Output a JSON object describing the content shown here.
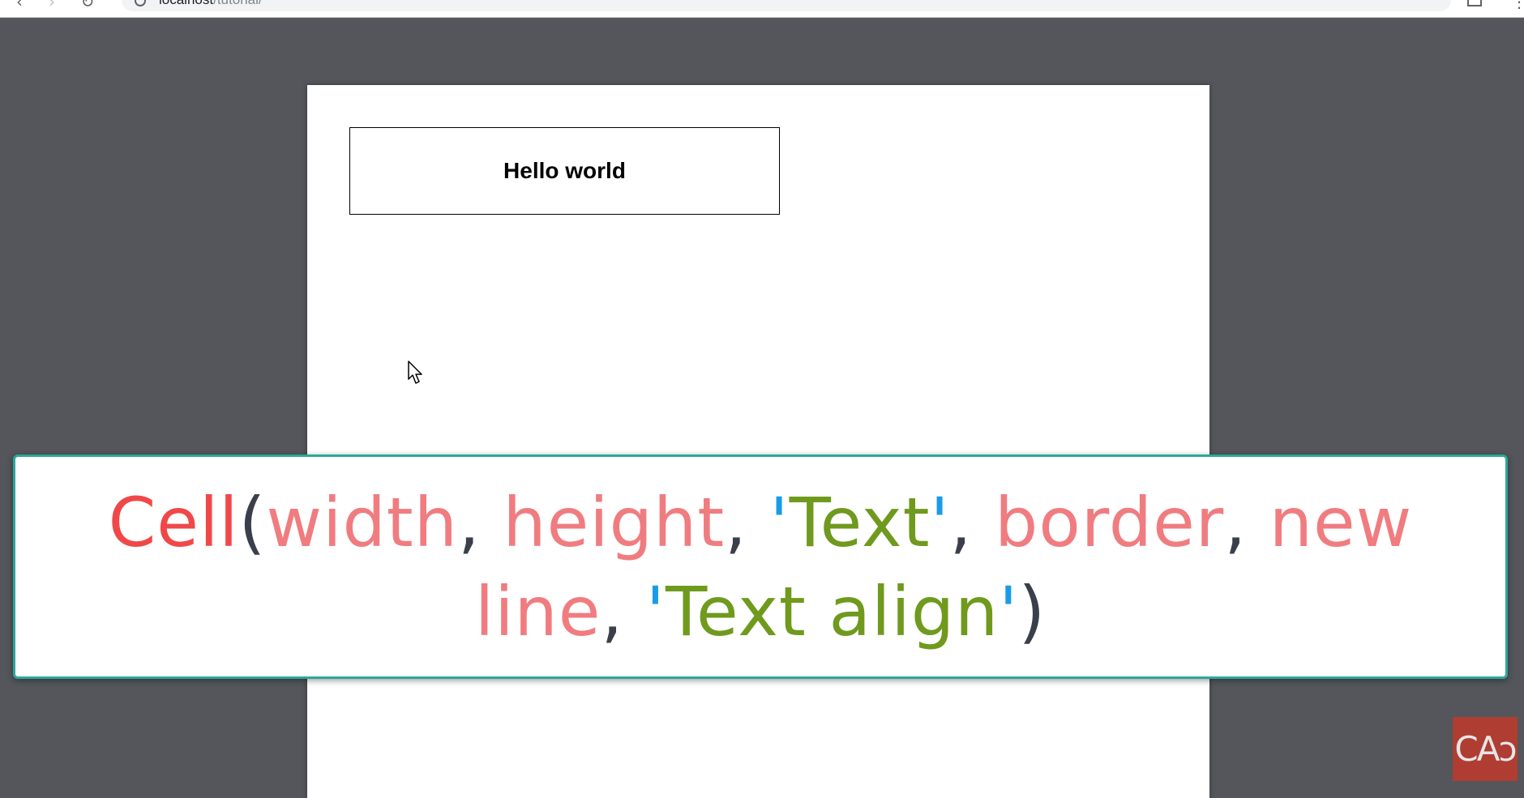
{
  "browser": {
    "back_icon": "arrow-left-icon",
    "forward_icon": "arrow-right-icon",
    "reload_icon": "reload-icon",
    "url_host": "localhost",
    "url_path": "/tutorial/"
  },
  "pdf": {
    "cell_text": "Hello world"
  },
  "caption": {
    "fn": "Cell",
    "open_paren": "(",
    "p_width": "width",
    "comma1": ", ",
    "p_height": "height",
    "comma2": ", ",
    "q1": "'",
    "s_text": "Text",
    "q2": "'",
    "comma3": ", ",
    "p_border": "border",
    "comma4": ", ",
    "p_newline": "new line",
    "comma5": ", ",
    "q3": "'",
    "s_align": "Text align",
    "q4": "'",
    "close_paren": ")"
  },
  "logo": {
    "text": "CAↄ"
  },
  "colors": {
    "function": "#f04848",
    "param": "#f07c80",
    "string": "#6f9a1e",
    "quote": "#1a9be8",
    "caption_border": "#2aa89a",
    "viewer_bg": "#54565b"
  }
}
